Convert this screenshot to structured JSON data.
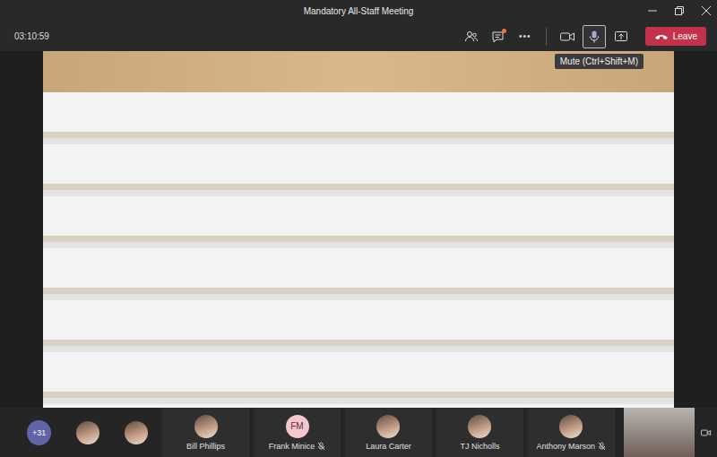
{
  "window": {
    "title": "Mandatory All-Staff Meeting"
  },
  "meeting": {
    "timer": "03:10:59"
  },
  "toolbar": [
    {
      "kind": "participants",
      "selected": false,
      "unread": false
    },
    {
      "kind": "chat",
      "selected": false,
      "unread": true
    },
    {
      "kind": "more",
      "label": "•••",
      "selected": false,
      "unread": false
    },
    {
      "kind": "camera",
      "selected": false,
      "unread": false
    },
    {
      "kind": "mic",
      "selected": true,
      "unread": false
    },
    {
      "kind": "share",
      "selected": false,
      "unread": false
    }
  ],
  "tooltip": {
    "text": "Mute (Ctrl+Shift+M)"
  },
  "leave_button": {
    "label": "Leave"
  },
  "roster": {
    "overflow": "+31",
    "avatars": [
      {
        "muted": false
      },
      {
        "muted": false
      }
    ],
    "tiles": [
      {
        "name": "Bill Phillips",
        "kind": "photo",
        "muted": false
      },
      {
        "name": "Frank Minice",
        "kind": "initials",
        "initials": "FM",
        "muted": true
      },
      {
        "name": "Laura Carter",
        "kind": "photo",
        "muted": false
      },
      {
        "name": "TJ Nicholls",
        "kind": "photo",
        "muted": false
      },
      {
        "name": "Anthony Marson",
        "kind": "photo",
        "muted": true
      }
    ]
  }
}
